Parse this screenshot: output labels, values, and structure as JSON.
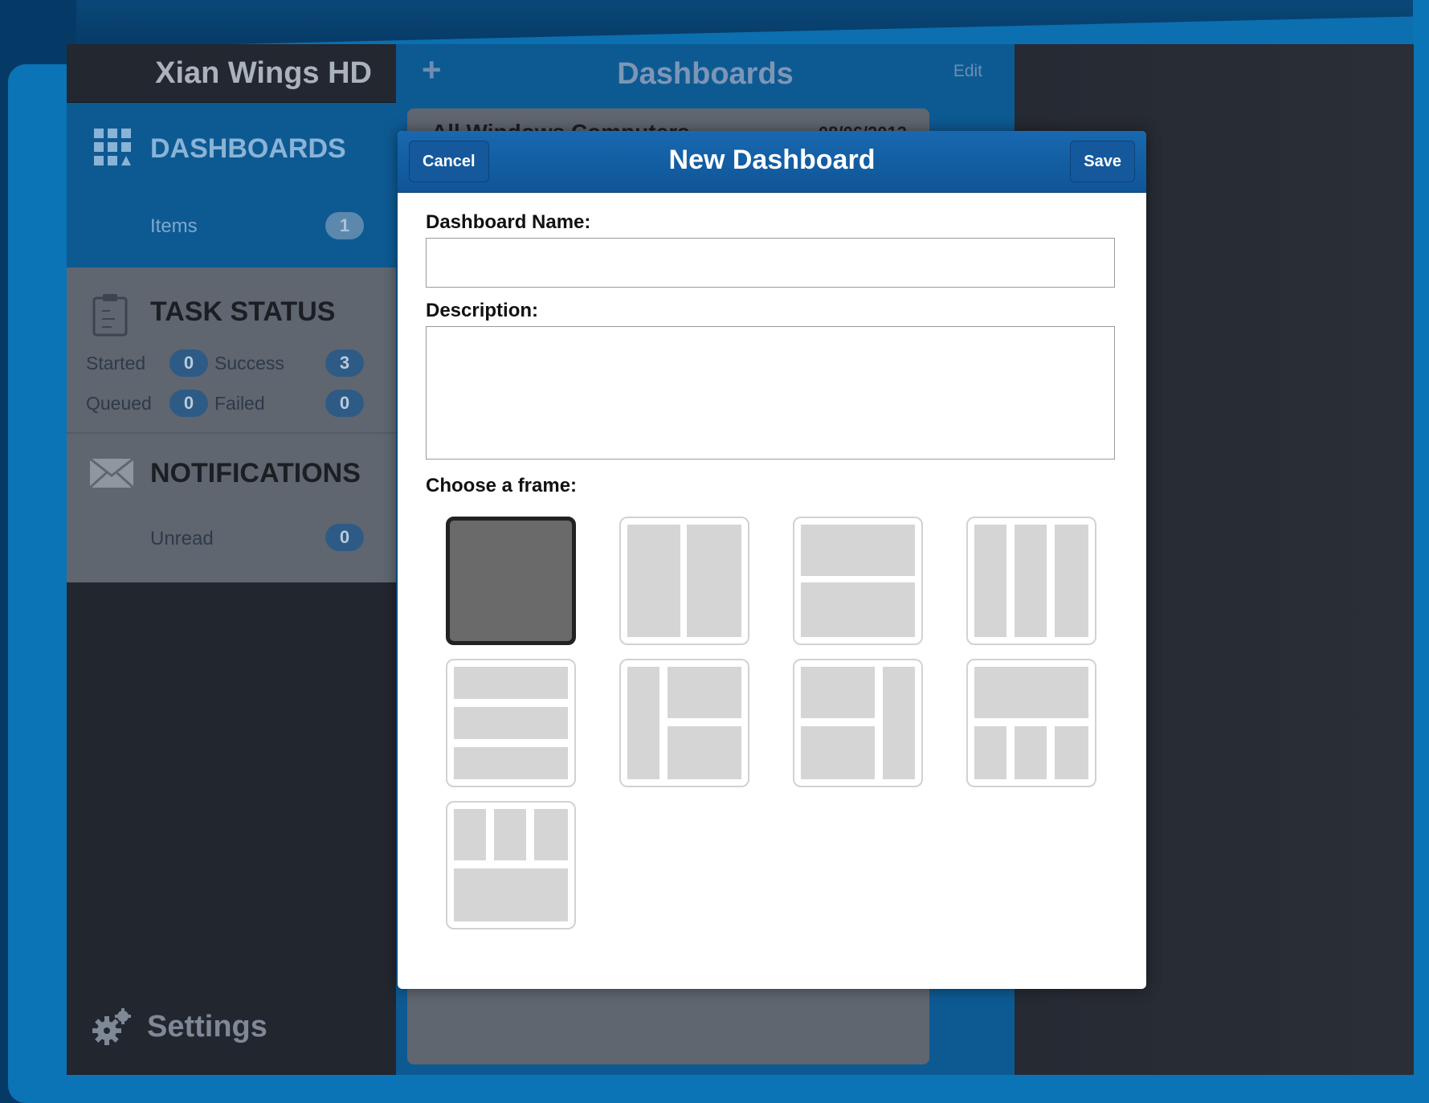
{
  "sidebar": {
    "app_title": "Xian Wings HD",
    "dashboards": {
      "label": "DASHBOARDS",
      "items_label": "Items",
      "items_count": "1",
      "icon": "grid-icon"
    },
    "task_status": {
      "label": "TASK STATUS",
      "icon": "clipboard-icon",
      "stats": [
        {
          "label": "Started",
          "count": "0"
        },
        {
          "label": "Success",
          "count": "3"
        },
        {
          "label": "Queued",
          "count": "0"
        },
        {
          "label": "Failed",
          "count": "0"
        }
      ]
    },
    "notifications": {
      "label": "NOTIFICATIONS",
      "icon": "envelope-icon",
      "unread_label": "Unread",
      "unread_count": "0"
    },
    "settings": {
      "label": "Settings",
      "icon": "gears-icon"
    }
  },
  "list_panel": {
    "add_label": "+",
    "title": "Dashboards",
    "edit_label": "Edit",
    "rows": [
      {
        "name": "All Windows Computers",
        "date": "08/06/2013"
      }
    ]
  },
  "modal": {
    "title": "New Dashboard",
    "cancel_label": "Cancel",
    "save_label": "Save",
    "name_label": "Dashboard Name:",
    "name_value": "",
    "description_label": "Description:",
    "description_value": "",
    "frame_label": "Choose a frame:",
    "frames": [
      {
        "layout": "single",
        "selected": true
      },
      {
        "layout": "two-columns",
        "selected": false
      },
      {
        "layout": "two-rows",
        "selected": false
      },
      {
        "layout": "three-columns",
        "selected": false
      },
      {
        "layout": "three-rows",
        "selected": false
      },
      {
        "layout": "left-column-right-two-rows",
        "selected": false
      },
      {
        "layout": "left-two-rows-right-column",
        "selected": false
      },
      {
        "layout": "top-row-bottom-three-columns",
        "selected": false
      },
      {
        "layout": "top-three-columns-bottom-row",
        "selected": false
      }
    ]
  },
  "colors": {
    "sidebar_dark": "#22262e",
    "accent_blue": "#0d5a93",
    "modal_bar": "#1868b0",
    "sidebar_gray": "#5f6670",
    "bezel_blue": "#0a74b6"
  }
}
